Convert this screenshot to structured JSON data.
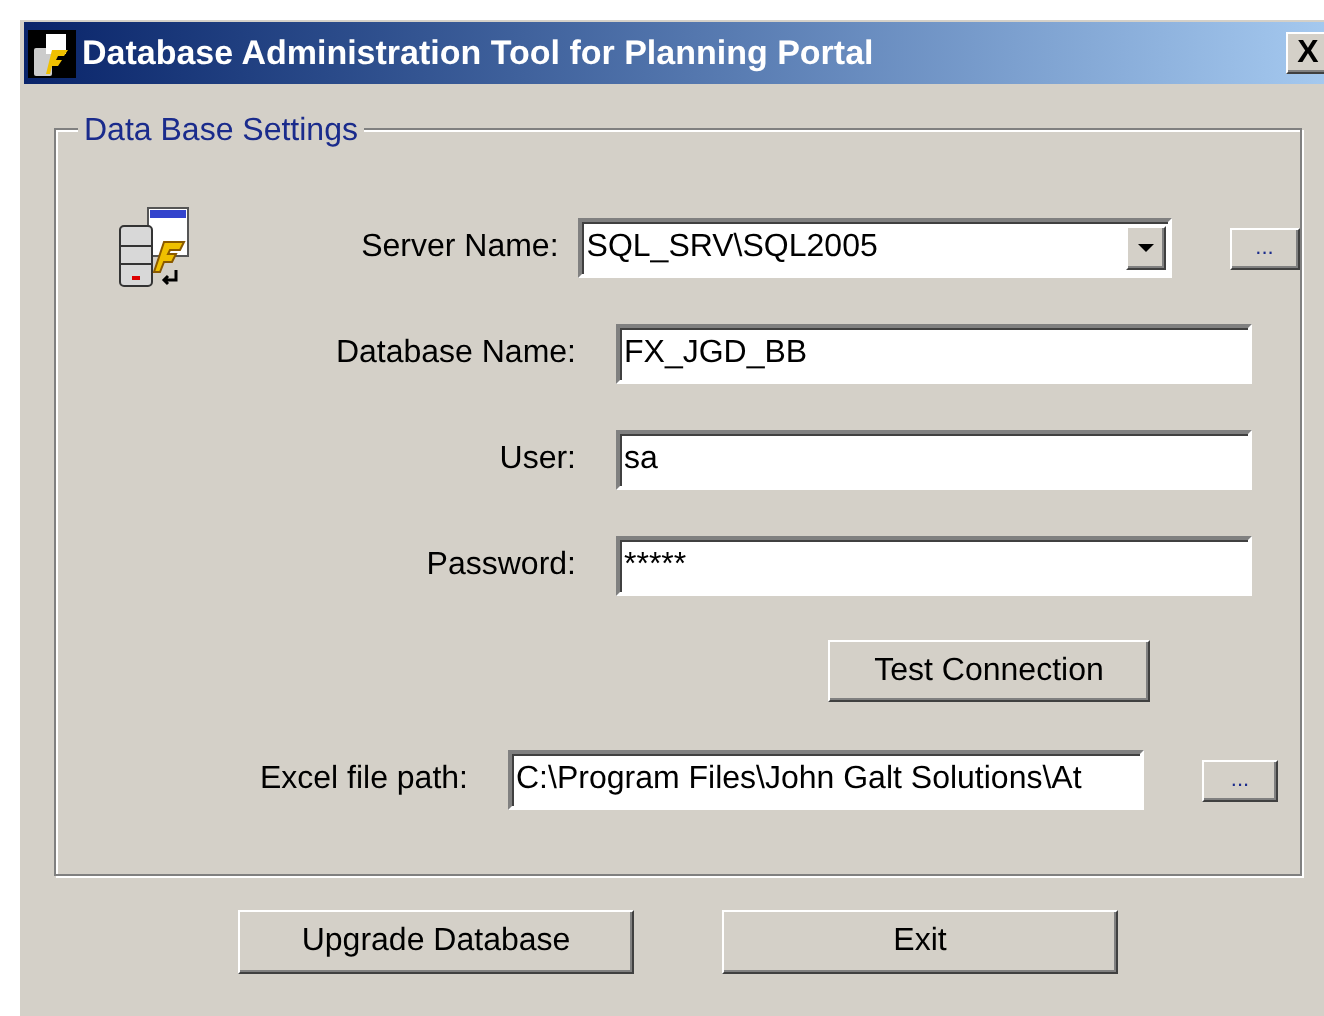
{
  "window": {
    "title": "Database Administration Tool for Planning Portal",
    "close": "X"
  },
  "group": {
    "title": "Data Base Settings",
    "fields": [
      {
        "kind": "combo",
        "label": "Server Name:",
        "value": "SQL_SRV\\SQL2005",
        "browse": "..."
      },
      {
        "kind": "text",
        "label": "Database Name:",
        "value": "FX_JGD_BB"
      },
      {
        "kind": "text",
        "label": "User:",
        "value": "sa"
      },
      {
        "kind": "text",
        "label": "Password:",
        "value": "*****"
      }
    ],
    "test_button": "Test Connection",
    "excel": {
      "label": "Excel file path:",
      "value": "C:\\Program Files\\John Galt Solutions\\At",
      "browse": "..."
    }
  },
  "buttons": [
    "Upgrade Database",
    "Exit"
  ]
}
